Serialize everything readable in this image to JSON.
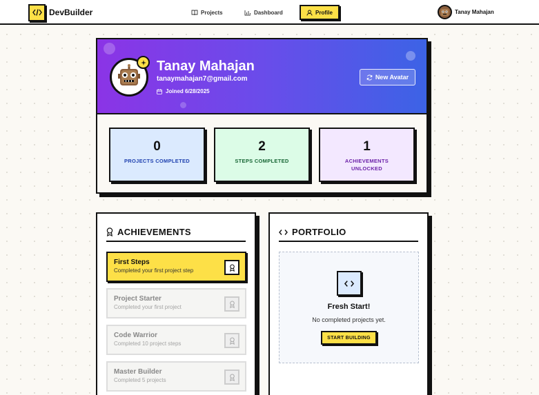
{
  "brand": {
    "name": "DevBuilder"
  },
  "nav": {
    "projects": "Projects",
    "dashboard": "Dashboard",
    "profile": "Profile"
  },
  "user": {
    "name": "Tanay Mahajan"
  },
  "profile": {
    "name": "Tanay Mahajan",
    "email": "tanaymahajan7@gmail.com",
    "joined": "Joined 6/28/2025",
    "new_avatar_label": "New Avatar"
  },
  "stats": {
    "projects": {
      "value": "0",
      "label": "PROJECTS COMPLETED"
    },
    "steps": {
      "value": "2",
      "label": "STEPS COMPLETED"
    },
    "achievements": {
      "value": "1",
      "label": "ACHIEVEMENTS UNLOCKED"
    }
  },
  "achievements": {
    "title": "ACHIEVEMENTS",
    "items": [
      {
        "title": "First Steps",
        "desc": "Completed your first project step",
        "unlocked": true
      },
      {
        "title": "Project Starter",
        "desc": "Completed your first project",
        "unlocked": false
      },
      {
        "title": "Code Warrior",
        "desc": "Completed 10 project steps",
        "unlocked": false
      },
      {
        "title": "Master Builder",
        "desc": "Completed 5 projects",
        "unlocked": false
      }
    ]
  },
  "portfolio": {
    "title": "PORTFOLIO",
    "empty_title": "Fresh Start!",
    "empty_sub": "No completed projects yet.",
    "button": "START BUILDING"
  },
  "colors": {
    "accent": "#fde047",
    "header_gradient_start": "#8b34e6",
    "header_gradient_end": "#3c63e6",
    "projects_bg": "#dbeafe",
    "projects_text": "#1e40af",
    "steps_bg": "#dcfce7",
    "steps_text": "#166534",
    "achievements_bg": "#f3e8ff",
    "achievements_text": "#6b21a8"
  },
  "icons": {
    "logo": "code-icon",
    "projects": "book-icon",
    "dashboard": "bar-chart-icon",
    "profile": "user-icon",
    "joined": "calendar-icon",
    "new_avatar": "refresh-icon",
    "achievement": "award-icon",
    "portfolio": "code-icon",
    "badge": "sparkle-icon"
  }
}
